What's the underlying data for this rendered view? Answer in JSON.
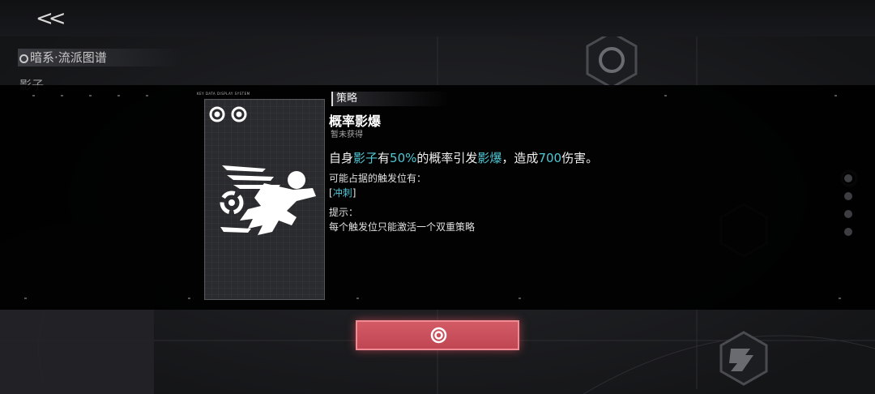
{
  "header": {
    "back_label": "<<",
    "school_title": "暗系·流派图谱",
    "subtitle": "影子"
  },
  "card": {
    "header_text": "KEY DATA DISPLAY SYSTEM",
    "icon": "shadow-runner-icon"
  },
  "detail": {
    "tag": "策略",
    "name": "概率影爆",
    "status": "暂未获得",
    "desc": {
      "p1": "自身",
      "k1": "影子",
      "p2": "有",
      "k2": "50%",
      "p3": "的概率引发",
      "k3": "影爆",
      "p4": "，造成",
      "k4": "700",
      "p5": "伤害。"
    },
    "slots_label": "可能占据的触发位有：",
    "slot_prefix": "[",
    "slot_name": "冲刺",
    "slot_suffix": "]",
    "tip_label": "提示：",
    "tip_text": "每个触发位只能激活一个双重策略"
  },
  "confirm": {
    "icon": "target-ring-icon"
  },
  "colors": {
    "accent": "#4fc7d4",
    "confirm": "#c84d59"
  }
}
